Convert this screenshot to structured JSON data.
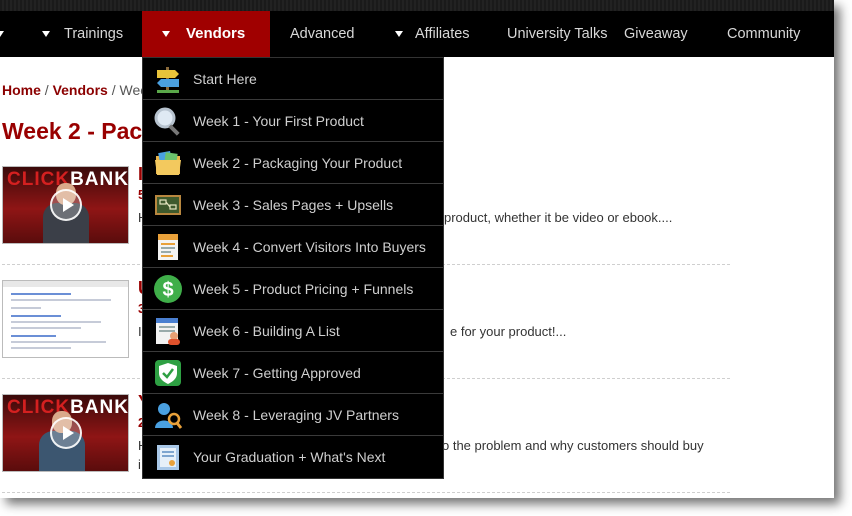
{
  "nav": {
    "items": [
      {
        "label": "Trainings",
        "dropdown": true
      },
      {
        "label": "Vendors",
        "dropdown": true,
        "active": true
      },
      {
        "label": "Advanced",
        "dropdown": false
      },
      {
        "label": "Affiliates",
        "dropdown": true
      },
      {
        "label": "University Talks",
        "dropdown": false
      },
      {
        "label": "Giveaway",
        "dropdown": false
      },
      {
        "label": "Community",
        "dropdown": false
      }
    ]
  },
  "breadcrumb": {
    "home": "Home",
    "vendors": "Vendors",
    "separator": "/",
    "current": "Wee"
  },
  "page": {
    "title": "Week 2 - Pac"
  },
  "lessons": [
    {
      "thumb": "clickbank-video",
      "letter": "I",
      "sub": "5",
      "text_start": "H",
      "text_end": "product, whether it be video or ebook...."
    },
    {
      "thumb": "screenshot",
      "letter": "U",
      "sub": "3",
      "text_start": "I",
      "text_end": "e for your product!..."
    },
    {
      "thumb": "clickbank-video",
      "letter": "Y",
      "sub": "2",
      "text_start": "H",
      "text_end": "o the problem and why customers should buy",
      "text_line2": "i"
    }
  ],
  "thumb_text": {
    "logo_red": "CLICK",
    "logo_white": "BANK"
  },
  "dropdown": {
    "items": [
      {
        "label": "Start Here",
        "icon": "signpost-icon"
      },
      {
        "label": "Week 1 - Your First Product",
        "icon": "magnifier-icon"
      },
      {
        "label": "Week 2 - Packaging Your Product",
        "icon": "folder-icon"
      },
      {
        "label": "Week 3 - Sales Pages + Upsells",
        "icon": "chalkboard-icon"
      },
      {
        "label": "Week 4 - Convert Visitors Into Buyers",
        "icon": "document-icon"
      },
      {
        "label": "Week 5 - Product Pricing + Funnels",
        "icon": "dollar-icon"
      },
      {
        "label": "Week 6 - Building A List",
        "icon": "contact-list-icon"
      },
      {
        "label": "Week 7 - Getting Approved",
        "icon": "shield-check-icon"
      },
      {
        "label": "Week 8 - Leveraging JV Partners",
        "icon": "partners-icon"
      },
      {
        "label": "Your Graduation + What's Next",
        "icon": "certificate-icon"
      }
    ]
  },
  "colors": {
    "accent": "#990000",
    "nav_bg": "#000000",
    "nav_active": "#a00000"
  }
}
